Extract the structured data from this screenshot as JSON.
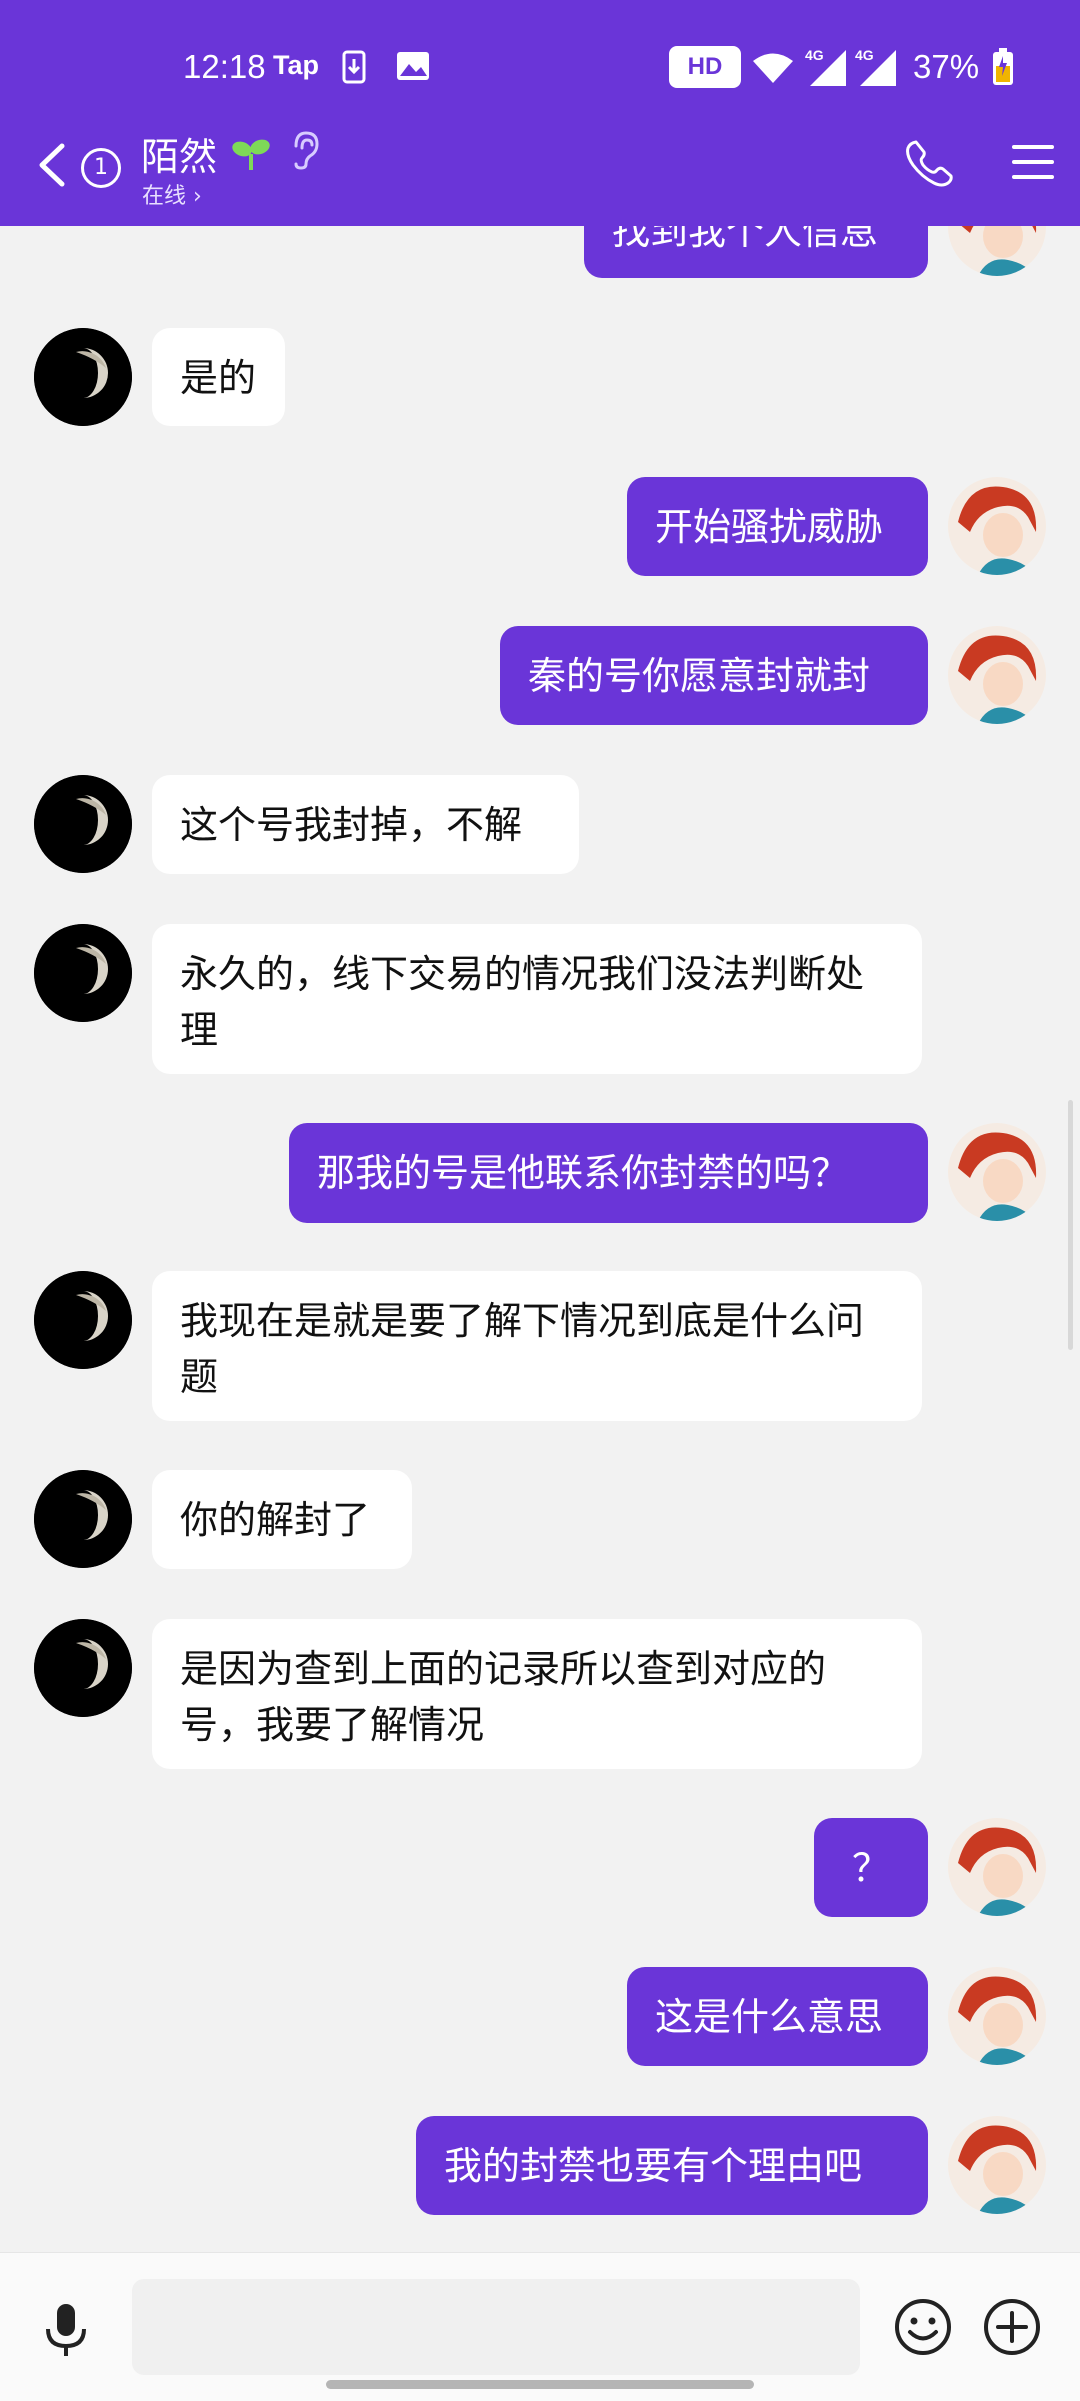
{
  "status_bar": {
    "time": "12:18",
    "app_label": "Tap",
    "hd_badge": "HD",
    "battery": "37%"
  },
  "header": {
    "unread_count": "1",
    "contact_name": "陌然",
    "status": "在线 ›"
  },
  "colors": {
    "accent": "#6a35d8",
    "incoming_bubble": "#ffffff",
    "background": "#f2f2f2"
  },
  "messages": [
    {
      "side": "out",
      "text": "找到我个人信息"
    },
    {
      "side": "in",
      "text": "是的"
    },
    {
      "side": "out",
      "text": "开始骚扰威胁"
    },
    {
      "side": "out",
      "text": "秦的号你愿意封就封"
    },
    {
      "side": "in",
      "text": "这个号我封掉，不解"
    },
    {
      "side": "in",
      "text": "永久的，线下交易的情况我们没法判断处理"
    },
    {
      "side": "out",
      "text": "那我的号是他联系你封禁的吗？"
    },
    {
      "side": "in",
      "text": "我现在是就是要了解下情况到底是什么问题"
    },
    {
      "side": "in",
      "text": "你的解封了"
    },
    {
      "side": "in",
      "text": "是因为查到上面的记录所以查到对应的号，我要了解情况"
    },
    {
      "side": "out",
      "text": "？"
    },
    {
      "side": "out",
      "text": "这是什么意思"
    },
    {
      "side": "out",
      "text": "我的封禁也要有个理由吧"
    }
  ],
  "composer": {
    "input_value": "",
    "placeholder": ""
  }
}
